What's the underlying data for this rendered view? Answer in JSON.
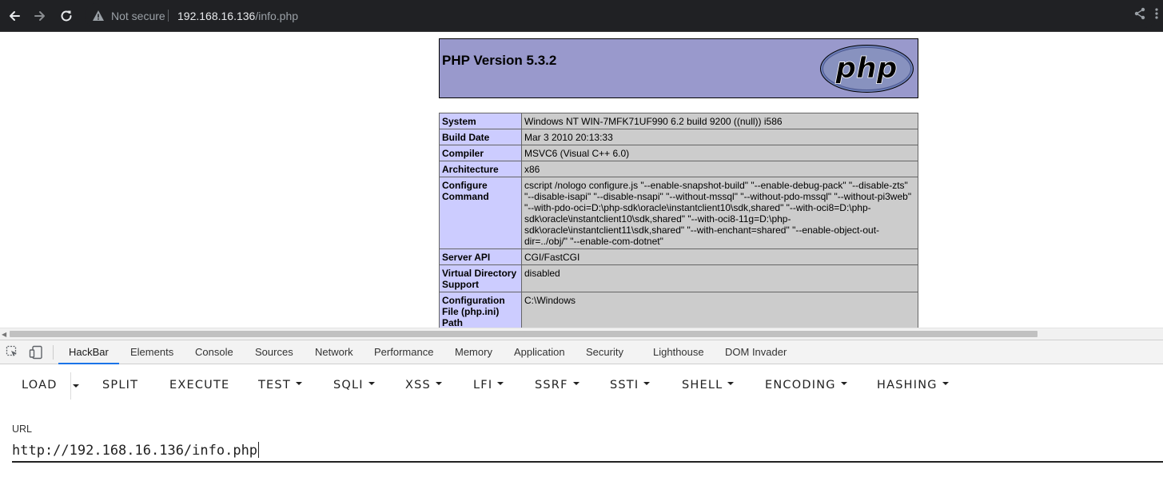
{
  "browser": {
    "security_label": "Not secure",
    "url_host": "192.168.16.136",
    "url_path": "/info.php"
  },
  "phpinfo": {
    "title": "PHP Version 5.3.2",
    "logo_text": "php",
    "rows": [
      {
        "key": "System",
        "value": "Windows NT WIN-7MFK71UF990 6.2 build 9200 ((null)) i586"
      },
      {
        "key": "Build Date",
        "value": "Mar 3 2010 20:13:33"
      },
      {
        "key": "Compiler",
        "value": "MSVC6 (Visual C++ 6.0)"
      },
      {
        "key": "Architecture",
        "value": "x86"
      },
      {
        "key": "Configure Command",
        "value": "cscript /nologo configure.js \"--enable-snapshot-build\" \"--enable-debug-pack\" \"--disable-zts\" \"--disable-isapi\" \"--disable-nsapi\" \"--without-mssql\" \"--without-pdo-mssql\" \"--without-pi3web\" \"--with-pdo-oci=D:\\php-sdk\\oracle\\instantclient10\\sdk,shared\" \"--with-oci8=D:\\php-sdk\\oracle\\instantclient10\\sdk,shared\" \"--with-oci8-11g=D:\\php-sdk\\oracle\\instantclient11\\sdk,shared\" \"--with-enchant=shared\" \"--enable-object-out-dir=../obj/\" \"--enable-com-dotnet\""
      },
      {
        "key": "Server API",
        "value": "CGI/FastCGI"
      },
      {
        "key": "Virtual Directory Support",
        "value": "disabled"
      },
      {
        "key": "Configuration File (php.ini) Path",
        "value": "C:\\Windows"
      }
    ]
  },
  "devtools": {
    "tabs": [
      {
        "label": "HackBar",
        "active": true
      },
      {
        "label": "Elements"
      },
      {
        "label": "Console"
      },
      {
        "label": "Sources"
      },
      {
        "label": "Network"
      },
      {
        "label": "Performance"
      },
      {
        "label": "Memory"
      },
      {
        "label": "Application"
      },
      {
        "label": "Security"
      },
      {
        "label": "Lighthouse"
      },
      {
        "label": "DOM Invader"
      }
    ]
  },
  "hackbar": {
    "buttons": [
      {
        "label": "LOAD"
      },
      {
        "label": "SPLIT"
      },
      {
        "label": "EXECUTE"
      },
      {
        "label": "TEST"
      },
      {
        "label": "SQLI"
      },
      {
        "label": "XSS"
      },
      {
        "label": "LFI"
      },
      {
        "label": "SSRF"
      },
      {
        "label": "SSTI"
      },
      {
        "label": "SHELL"
      },
      {
        "label": "ENCODING"
      },
      {
        "label": "HASHING"
      }
    ],
    "url_label": "URL",
    "url_value": "http://192.168.16.136/info.php"
  },
  "colors": {
    "php_header_bg": "#9999cc",
    "php_key_bg": "#ccccff",
    "php_value_bg": "#cccccc",
    "devtools_active_tab": "#1a73e8",
    "browser_chrome": "#202124"
  },
  "icons": [
    "back-arrow-icon",
    "forward-arrow-icon",
    "reload-icon",
    "warning-icon",
    "share-icon",
    "inspect-element-icon",
    "device-toolbar-icon"
  ]
}
